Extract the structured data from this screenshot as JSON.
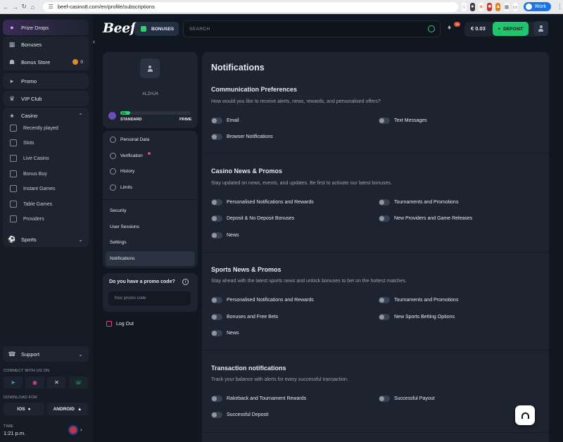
{
  "browser": {
    "url": "beef-casino8.com/en/profile/subscriptions",
    "profile_label": "Work"
  },
  "sidebar": {
    "items": [
      {
        "label": "Prize Drops"
      },
      {
        "label": "Bonuses"
      },
      {
        "label": "Bonus Store",
        "count": "0"
      },
      {
        "label": "Promo"
      },
      {
        "label": "VIP Club"
      },
      {
        "label": "Casino"
      },
      {
        "label": "Sports"
      },
      {
        "label": "Support"
      }
    ],
    "casino_sub": [
      "Recently played",
      "Slots",
      "Live Casino",
      "Bonus Buy",
      "Instant Games",
      "Table Games",
      "Providers"
    ],
    "connect_label": "CONNECT WITH US ON",
    "download_label": "DOWNLOAD FOR",
    "ios_label": "IOS",
    "android_label": "ANDROID",
    "time_label": "TIME",
    "time_value": "1:21 p.m."
  },
  "header": {
    "logo": "Beef",
    "bonuses_label": "BONUSES",
    "search_placeholder": "SEARCH",
    "notif_count": "10",
    "balance": "€ 0.03",
    "deposit_label": "DEPOSIT"
  },
  "profile": {
    "user_id": "#LZHJ4",
    "progress_label": "3%",
    "progress_fraction": 0.03,
    "level_current": "STANDARD",
    "level_next": "PRIME",
    "menu": [
      "Personal Data",
      "Verification",
      "History",
      "Limits",
      "Security",
      "User Sessions",
      "Settings",
      "Notifications"
    ],
    "promo_title": "Do you have a promo code?",
    "promo_placeholder": "Your promo code",
    "logout_label": "Log Out"
  },
  "notifications": {
    "title": "Notifications",
    "sections": [
      {
        "title": "Communication Preferences",
        "desc": "How would you like to receive alerts, news, rewards, and personalised offers?",
        "options": [
          "Email",
          "Text Messages",
          "Browser Notifications"
        ]
      },
      {
        "title": "Casino News & Promos",
        "desc": "Stay updated on news, events, and updates. Be first to activate our latest bonuses.",
        "options": [
          "Personalised Notifications and Rewards",
          "Tournaments and Promotions",
          "Deposit & No Deposit Bonuses",
          "New Providers and Game Releases",
          "News"
        ]
      },
      {
        "title": "Sports News & Promos",
        "desc": "Stay ahead with the latest sports news and unlock bonuses to bet on the hottest matches.",
        "options": [
          "Personalised Notifications and Rewards",
          "Tournaments and Promotions",
          "Bonuses and Free Bets",
          "New Sports Betting Options",
          "News"
        ]
      },
      {
        "title": "Transaction notifications",
        "desc": "Track your balance with alerts for every successful transaction.",
        "options": [
          "Rakeback and Tournament Rewards",
          "Successful Payout",
          "Successful Deposit"
        ]
      }
    ]
  },
  "colors": {
    "accent": "#22c56d",
    "panel": "#1d2430",
    "background": "#111720"
  }
}
